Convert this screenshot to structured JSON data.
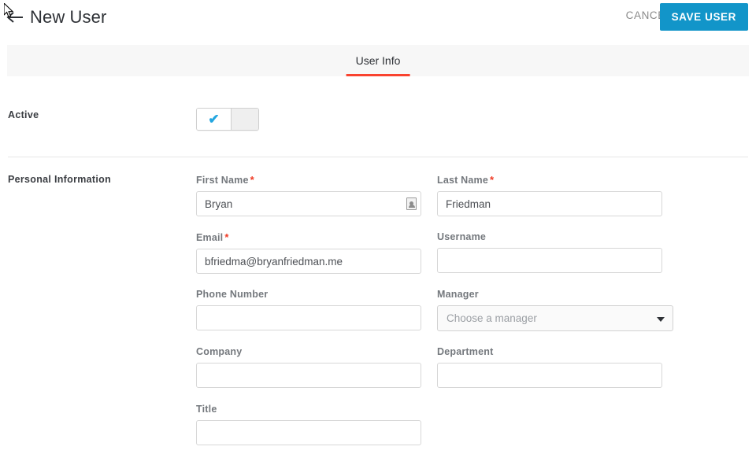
{
  "header": {
    "back_icon": "back-arrow-icon",
    "title": "New User",
    "cancel_label": "CANCEL",
    "save_label": "SAVE USER",
    "accent_blue": "#1295c9"
  },
  "tabs": [
    {
      "label": "User Info",
      "active": true,
      "underline_color": "#f9432f"
    }
  ],
  "sections": {
    "active": {
      "label": "Active",
      "toggle": {
        "state": "on",
        "check_icon": "check-icon",
        "check_color": "#23a6e0"
      }
    },
    "personal": {
      "label": "Personal Information",
      "required_marker": "*",
      "required_color": "#f03a24",
      "fields": [
        {
          "name": "first_name",
          "label": "First Name",
          "required": true,
          "value": "Bryan",
          "placeholder": "",
          "type": "text",
          "trailing_icon": "contact-card-autofill-icon"
        },
        {
          "name": "last_name",
          "label": "Last Name",
          "required": true,
          "value": "Friedman",
          "placeholder": "",
          "type": "text"
        },
        {
          "name": "email",
          "label": "Email",
          "required": true,
          "value": "bfriedma@bryanfriedman.me",
          "placeholder": "",
          "type": "text"
        },
        {
          "name": "username",
          "label": "Username",
          "required": false,
          "value": "",
          "placeholder": "",
          "type": "text"
        },
        {
          "name": "phone_number",
          "label": "Phone Number",
          "required": false,
          "value": "",
          "placeholder": "",
          "type": "text"
        },
        {
          "name": "manager",
          "label": "Manager",
          "required": false,
          "value": "Choose a manager",
          "type": "select",
          "caret_icon": "chevron-down-icon"
        },
        {
          "name": "company",
          "label": "Company",
          "required": false,
          "value": "",
          "placeholder": "",
          "type": "text"
        },
        {
          "name": "department",
          "label": "Department",
          "required": false,
          "value": "",
          "placeholder": "",
          "type": "text"
        },
        {
          "name": "title",
          "label": "Title",
          "required": false,
          "value": "",
          "placeholder": "",
          "type": "text"
        }
      ]
    }
  }
}
